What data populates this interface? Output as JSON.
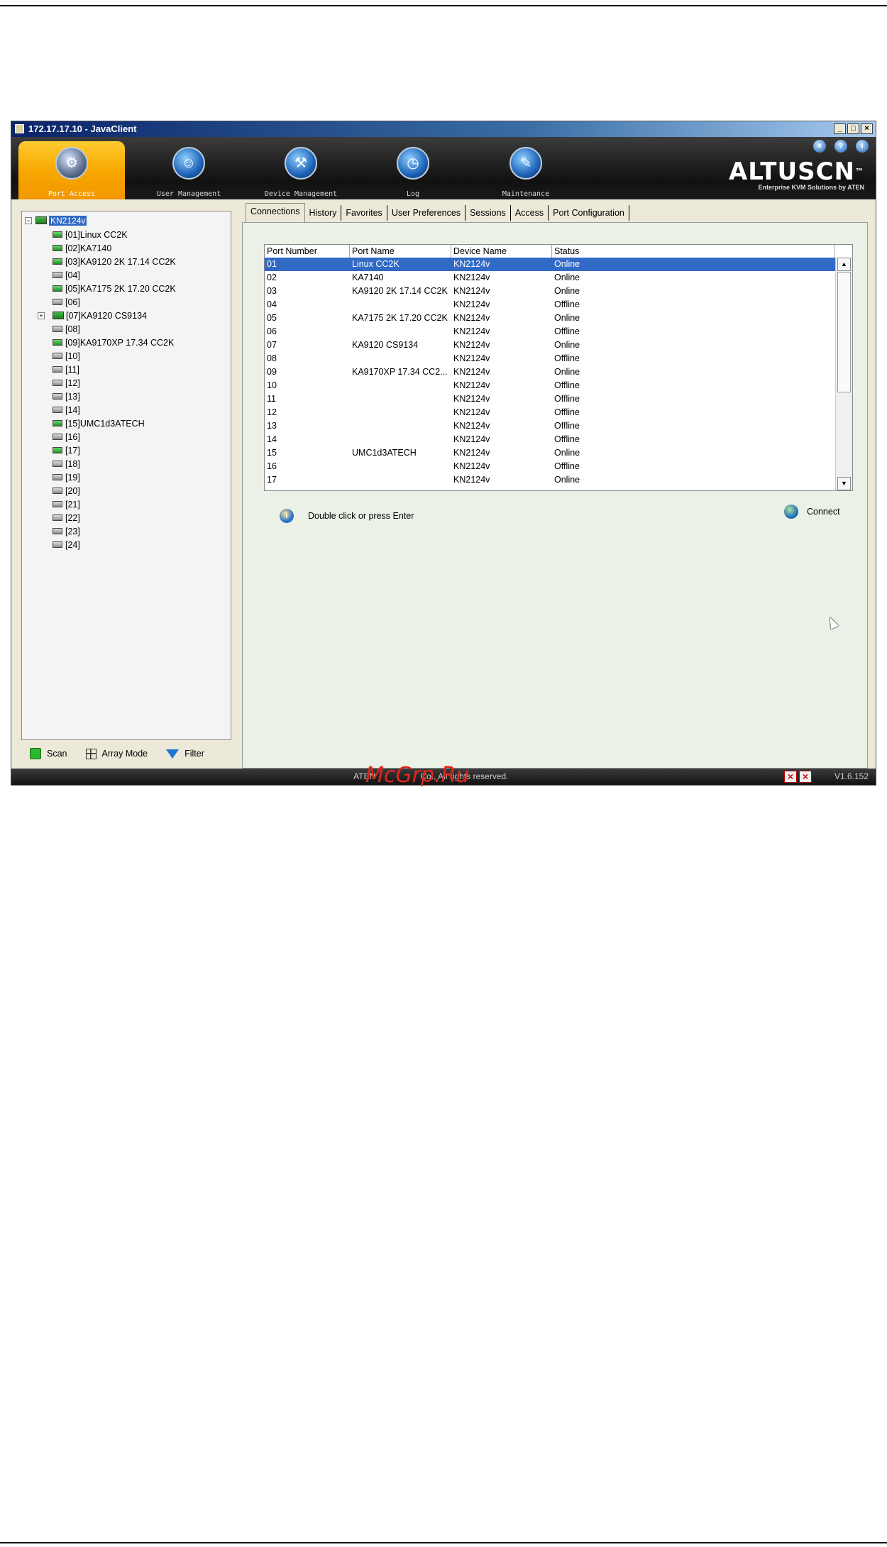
{
  "window": {
    "title": "172.17.17.10 - JavaClient",
    "minimize": "_",
    "maximize": "□",
    "close": "×"
  },
  "nav": [
    {
      "label": "Port Access",
      "icon": "port-access-icon",
      "active": true
    },
    {
      "label": "User Management",
      "icon": "user-management-icon"
    },
    {
      "label": "Device Management",
      "icon": "device-management-icon"
    },
    {
      "label": "Log",
      "icon": "log-icon"
    },
    {
      "label": "Maintenance",
      "icon": "maintenance-icon"
    }
  ],
  "topIcons": [
    "×",
    "?",
    "i"
  ],
  "brand": {
    "name": "ALTUSCN",
    "tm": "™",
    "tagline": "Enterprise KVM Solutions by ATEN"
  },
  "tree": {
    "root": "KN2124v",
    "collapse": "−",
    "expand": "+",
    "items": [
      {
        "label": "[01]Linux CC2K",
        "online": true
      },
      {
        "label": "[02]KA7140",
        "online": true
      },
      {
        "label": "[03]KA9120 2K 17.14 CC2K",
        "online": true
      },
      {
        "label": "[04]",
        "online": false
      },
      {
        "label": "[05]KA7175 2K 17.20 CC2K",
        "online": true
      },
      {
        "label": "[06]",
        "online": false
      },
      {
        "label": "[07]KA9120 CS9134",
        "online": true,
        "expandable": true
      },
      {
        "label": "[08]",
        "online": false
      },
      {
        "label": "[09]KA9170XP 17.34 CC2K",
        "online": true
      },
      {
        "label": "[10]",
        "online": false
      },
      {
        "label": "[11]",
        "online": false
      },
      {
        "label": "[12]",
        "online": false
      },
      {
        "label": "[13]",
        "online": false
      },
      {
        "label": "[14]",
        "online": false
      },
      {
        "label": "[15]UMC1d3ATECH",
        "online": true
      },
      {
        "label": "[16]",
        "online": false
      },
      {
        "label": "[17]",
        "online": true
      },
      {
        "label": "[18]",
        "online": false
      },
      {
        "label": "[19]",
        "online": false
      },
      {
        "label": "[20]",
        "online": false
      },
      {
        "label": "[21]",
        "online": false
      },
      {
        "label": "[22]",
        "online": false
      },
      {
        "label": "[23]",
        "online": false
      },
      {
        "label": "[24]",
        "online": false
      }
    ]
  },
  "footer": {
    "scan": "Scan",
    "arrayMode": "Array Mode",
    "filter": "Filter"
  },
  "tabs": [
    "Connections",
    "History",
    "Favorites",
    "User Preferences",
    "Sessions",
    "Access",
    "Port Configuration"
  ],
  "table": {
    "headers": [
      "Port Number",
      "Port Name",
      "Device Name",
      "Status"
    ],
    "rows": [
      [
        "01",
        "Linux CC2K",
        "KN2124v",
        "Online"
      ],
      [
        "02",
        "KA7140",
        "KN2124v",
        "Online"
      ],
      [
        "03",
        "KA9120 2K 17.14 CC2K",
        "KN2124v",
        "Online"
      ],
      [
        "04",
        "",
        "KN2124v",
        "Offline"
      ],
      [
        "05",
        "KA7175 2K 17.20 CC2K",
        "KN2124v",
        "Online"
      ],
      [
        "06",
        "",
        "KN2124v",
        "Offline"
      ],
      [
        "07",
        "KA9120 CS9134",
        "KN2124v",
        "Online"
      ],
      [
        "08",
        "",
        "KN2124v",
        "Offline"
      ],
      [
        "09",
        "KA9170XP 17.34 CC2...",
        "KN2124v",
        "Online"
      ],
      [
        "10",
        "",
        "KN2124v",
        "Offline"
      ],
      [
        "11",
        "",
        "KN2124v",
        "Offline"
      ],
      [
        "12",
        "",
        "KN2124v",
        "Offline"
      ],
      [
        "13",
        "",
        "KN2124v",
        "Offline"
      ],
      [
        "14",
        "",
        "KN2124v",
        "Offline"
      ],
      [
        "15",
        "UMC1d3ATECH",
        "KN2124v",
        "Online"
      ],
      [
        "16",
        "",
        "KN2124v",
        "Offline"
      ],
      [
        "17",
        "",
        "KN2124v",
        "Online"
      ]
    ],
    "selectedRow": 0,
    "scrollUp": "▲",
    "scrollDown": "▼"
  },
  "hint": "Double click or press Enter",
  "connect": "Connect",
  "infoGlyph": "i",
  "status": {
    "copyright": "ATEN",
    "copyrightTail": "Co., All rights reserved.",
    "watermark": "McGrp.Ru",
    "version": "V1.6.152",
    "iconGlyph": "×"
  }
}
